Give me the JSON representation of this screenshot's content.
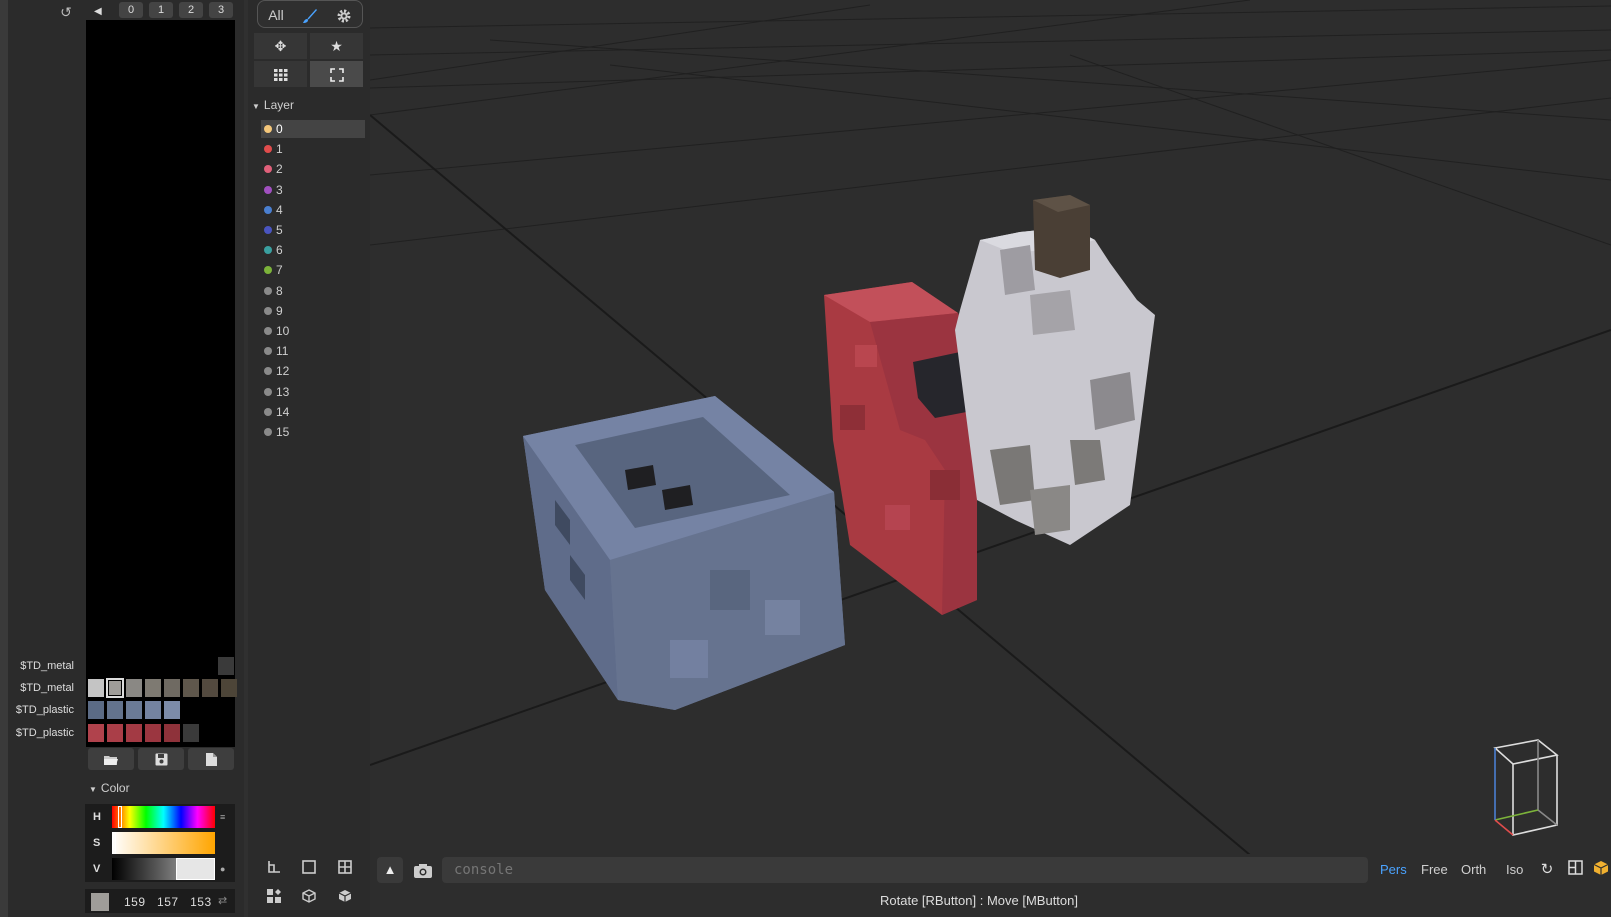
{
  "palette": {
    "undo_icon": "undo-icon",
    "prev_icon": "◀",
    "pages": [
      "0",
      "1",
      "2",
      "3"
    ],
    "materials": [
      "$TD_metal",
      "$TD_metal",
      "$TD_plastic",
      "$TD_plastic"
    ],
    "rows": [
      [
        "#3a3a3a"
      ],
      [
        "#c4c4c4",
        "#9f9d99",
        "#8a8884",
        "#7e7a72",
        "#6f6a62",
        "#5f574c",
        "#534a3f",
        "#4d4538"
      ],
      [
        "#5b6b85",
        "#63738d",
        "#6b7b96",
        "#7483a0",
        "#7c8ba8"
      ],
      [
        "#b0424c",
        "#aa3e48",
        "#a33a44",
        "#9b3640",
        "#8e323a",
        "#3a3a3a"
      ]
    ],
    "file_buttons": [
      "folder-open-icon",
      "save-icon",
      "new-file-icon"
    ]
  },
  "color": {
    "section_title": "Color",
    "h_label": "H",
    "s_label": "S",
    "v_label": "V",
    "hue_fraction": 0.08,
    "sat_fraction": 0.02,
    "val_fraction": 0.62,
    "r": "159",
    "g": "157",
    "b": "153",
    "current_hex": "#9f9d99"
  },
  "tools": {
    "all_label": "All",
    "icons": [
      "brush-icon",
      "gear-icon"
    ],
    "modes": [
      "move-icon",
      "star-icon",
      "grid-icon",
      "fullscreen-icon"
    ]
  },
  "layers": {
    "section_title": "Layer",
    "items": [
      {
        "label": "0",
        "color": "#f4c77a"
      },
      {
        "label": "1",
        "color": "#e04c4c"
      },
      {
        "label": "2",
        "color": "#e0607a"
      },
      {
        "label": "3",
        "color": "#a150c0"
      },
      {
        "label": "4",
        "color": "#4a7fd0"
      },
      {
        "label": "5",
        "color": "#4a55c0"
      },
      {
        "label": "6",
        "color": "#3aa0a0"
      },
      {
        "label": "7",
        "color": "#7cb33a"
      },
      {
        "label": "8",
        "color": "#8a8a8a"
      },
      {
        "label": "9",
        "color": "#8a8a8a"
      },
      {
        "label": "10",
        "color": "#8a8a8a"
      },
      {
        "label": "11",
        "color": "#8a8a8a"
      },
      {
        "label": "12",
        "color": "#8a8a8a"
      },
      {
        "label": "13",
        "color": "#8a8a8a"
      },
      {
        "label": "14",
        "color": "#8a8a8a"
      },
      {
        "label": "15",
        "color": "#8a8a8a"
      }
    ]
  },
  "bottom": {
    "console_placeholder": "console",
    "view_modes": [
      "Pers",
      "Free",
      "Orth",
      "Iso"
    ],
    "status": "Rotate [RButton] : Move [MButton]"
  }
}
